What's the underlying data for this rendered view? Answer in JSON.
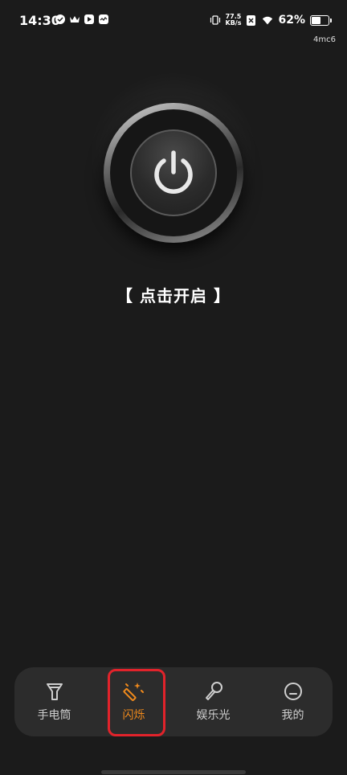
{
  "status_bar": {
    "time": "14:30",
    "net_speed_value": "77.5",
    "net_speed_unit": "KB/s",
    "battery_percent": "62%",
    "battery_level": 0.62
  },
  "watermark": "4mc6",
  "main": {
    "hint": "【 点击开启 】"
  },
  "tabs": [
    {
      "label": "手电筒",
      "icon": "flashlight-icon",
      "active": false
    },
    {
      "label": "闪烁",
      "icon": "magic-wand-icon",
      "active": true
    },
    {
      "label": "娱乐光",
      "icon": "microphone-icon",
      "active": false
    },
    {
      "label": "我的",
      "icon": "profile-face-icon",
      "active": false
    }
  ],
  "colors": {
    "background": "#1b1b1b",
    "active_tab": "#f08a1c",
    "highlight": "#e2232b"
  }
}
